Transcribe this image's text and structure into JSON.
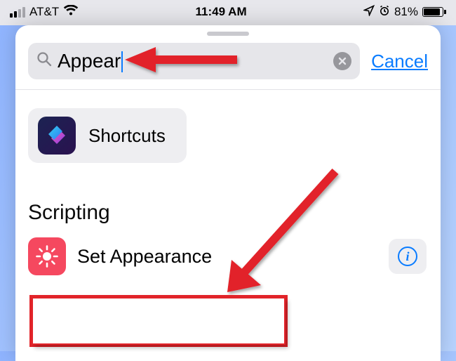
{
  "status": {
    "carrier": "AT&T",
    "time": "11:49 AM",
    "battery_text": "81%",
    "battery_fill_percent": 81
  },
  "search": {
    "value": "Appear",
    "placeholder": "Search",
    "cancel_label": "Cancel"
  },
  "suggested_app": {
    "name": "Shortcuts"
  },
  "section": {
    "title": "Scripting"
  },
  "action": {
    "label": "Set Appearance",
    "icon": "brightness-icon"
  },
  "annotation": {
    "arrow1": "points to search field text",
    "arrow2": "points to Set Appearance action",
    "highlight_box": "around Set Appearance action"
  }
}
